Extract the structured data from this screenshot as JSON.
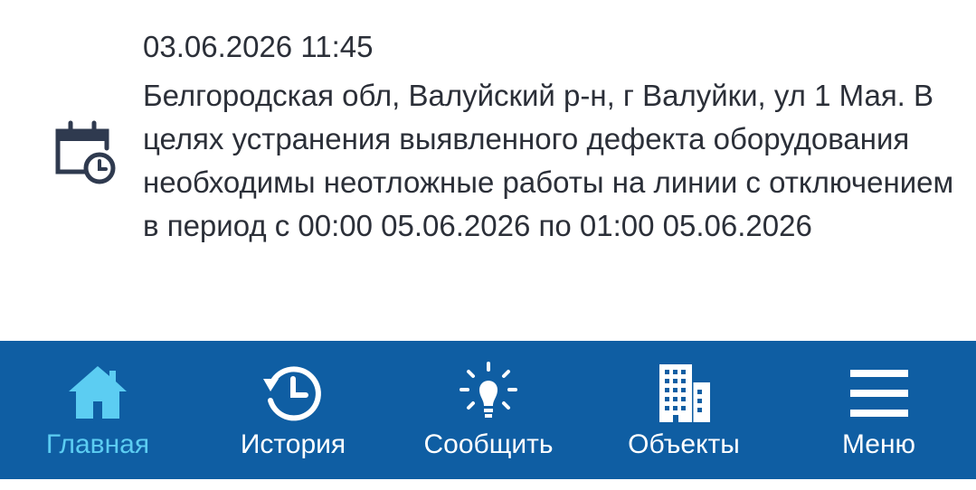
{
  "notice": {
    "icon": "calendar-clock-icon",
    "datetime": "03.06.2026 11:45",
    "text": "Белгородская обл, Валуйский р-н, г Валуйки, ул 1 Мая. В целях устранения выявленного дефекта оборудования необходимы неотложные работы на линии с отключением в период с 00:00 05.06.2026 по 01:00 05.06.2026"
  },
  "navbar": {
    "background": "#0f5ea3",
    "active_color": "#5ccdf2",
    "items": [
      {
        "label": "Главная",
        "icon": "home-icon",
        "active": true
      },
      {
        "label": "История",
        "icon": "history-icon",
        "active": false
      },
      {
        "label": "Сообщить",
        "icon": "lightbulb-icon",
        "active": false
      },
      {
        "label": "Объекты",
        "icon": "buildings-icon",
        "active": false
      },
      {
        "label": "Меню",
        "icon": "hamburger-menu-icon",
        "active": false
      }
    ]
  }
}
